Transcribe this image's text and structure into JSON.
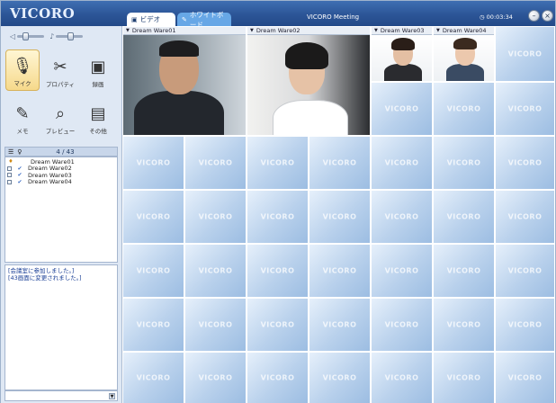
{
  "app": {
    "logo": "VICORO",
    "meeting_title": "VICORO Meeting",
    "timer": "00:03:34"
  },
  "tabs": [
    {
      "label": "ビデオ",
      "icon": "video-icon"
    },
    {
      "label": "ホワイトボード",
      "icon": "whiteboard-icon"
    }
  ],
  "toolbar": {
    "items": [
      {
        "label": "マイク",
        "icon": "microphone-icon"
      },
      {
        "label": "プロパティ",
        "icon": "properties-icon"
      },
      {
        "label": "録画",
        "icon": "record-icon"
      },
      {
        "label": "メモ",
        "icon": "memo-icon"
      },
      {
        "label": "プレビュー",
        "icon": "preview-icon"
      },
      {
        "label": "その他",
        "icon": "other-icon"
      }
    ]
  },
  "members": {
    "count": "4 / 43",
    "list": [
      {
        "name": "Dream Ware01",
        "host": true
      },
      {
        "name": "Dream Ware02",
        "host": false
      },
      {
        "name": "Dream Ware03",
        "host": false
      },
      {
        "name": "Dream Ware04",
        "host": false
      }
    ]
  },
  "chat": {
    "lines": [
      "[会議室に参加しました。]",
      "[43画面に変更されました。]"
    ]
  },
  "video": {
    "feeds": [
      {
        "label": "Dream Ware01"
      },
      {
        "label": "Dream Ware02"
      },
      {
        "label": "Dream Ware03"
      },
      {
        "label": "Dream Ware04"
      }
    ],
    "placeholder_text": "VICORO"
  },
  "colors": {
    "titlebar": "#2c5597",
    "active_tool": "#f6d98b",
    "panel_bg": "#dfe8f4",
    "chat_text": "#1a3f96"
  }
}
